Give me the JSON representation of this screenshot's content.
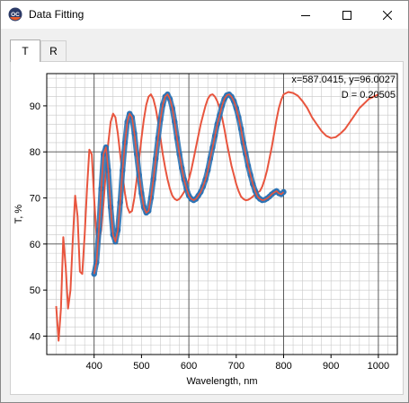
{
  "window": {
    "title": "Data Fitting",
    "icon": "app-logo-icon",
    "controls": {
      "minimize": "minimize-icon",
      "maximize": "maximize-icon",
      "close": "close-icon"
    }
  },
  "tabs": [
    {
      "label": "T",
      "active": true
    },
    {
      "label": "R",
      "active": false
    }
  ],
  "readout": {
    "coords": "x=587.0415, y=96.0027",
    "d_value": "D = 0.20505"
  },
  "colors": {
    "measured": "#2e74b5",
    "fit": "#e8553e",
    "grid_major": "#4d4d4d",
    "grid_minor": "#c8c8c8"
  },
  "chart_data": {
    "type": "line",
    "xlabel": "Wavelength, nm",
    "ylabel": "T, %",
    "xlim": [
      300,
      1040
    ],
    "ylim": [
      36,
      97
    ],
    "xticks": [
      400,
      500,
      600,
      700,
      800,
      900,
      1000
    ],
    "yticks": [
      40,
      50,
      60,
      70,
      80,
      90
    ],
    "grid": true,
    "series": [
      {
        "kind": "line",
        "color": "#e8553e",
        "x": [
          320,
          325,
          330,
          335,
          340,
          345,
          350,
          355,
          360,
          365,
          370,
          375,
          380,
          385,
          390,
          395,
          400,
          405,
          410,
          415,
          420,
          425,
          430,
          435,
          440,
          445,
          450,
          455,
          460,
          465,
          470,
          475,
          480,
          485,
          490,
          495,
          500,
          505,
          510,
          515,
          520,
          525,
          530,
          535,
          540,
          545,
          550,
          555,
          560,
          565,
          570,
          575,
          580,
          585,
          590,
          595,
          600,
          605,
          610,
          615,
          620,
          625,
          630,
          635,
          640,
          645,
          650,
          655,
          660,
          665,
          670,
          675,
          680,
          685,
          690,
          695,
          700,
          705,
          710,
          715,
          720,
          725,
          730,
          735,
          740,
          745,
          750,
          755,
          760,
          765,
          770,
          775,
          780,
          785,
          790,
          795,
          800,
          810,
          820,
          830,
          840,
          850,
          860,
          870,
          880,
          890,
          900,
          910,
          920,
          930,
          940,
          950,
          960,
          970,
          980,
          990,
          1000
        ],
        "y": [
          46.5,
          39,
          46,
          61.5,
          55,
          46,
          50,
          61,
          70.5,
          66,
          54,
          53.5,
          62,
          72,
          80.5,
          79.5,
          70,
          62,
          60.5,
          63,
          69,
          76,
          82,
          86.5,
          88.3,
          87.5,
          84,
          79.5,
          75,
          71,
          68,
          66.8,
          67.2,
          70,
          74,
          78.5,
          83,
          87,
          90.2,
          92,
          92.5,
          91.5,
          89.5,
          86.5,
          83,
          79.5,
          76.5,
          74,
          72,
          70.5,
          69.8,
          69.5,
          69.8,
          70.5,
          71.3,
          72.5,
          74,
          76,
          78.5,
          81,
          83.5,
          86,
          88,
          90,
          91.5,
          92.3,
          92.5,
          92,
          91,
          89.5,
          87.5,
          85,
          82,
          79.5,
          77,
          75,
          73,
          71.5,
          70.3,
          69.8,
          69.5,
          69.6,
          69.9,
          70.3,
          70.8,
          71.2,
          71.5,
          72.5,
          74,
          76,
          78.5,
          81,
          84,
          87,
          89.5,
          91.3,
          92.5,
          93,
          92.8,
          92.2,
          91,
          89.5,
          87.5,
          86,
          84.5,
          83.5,
          83,
          83.2,
          84,
          85,
          86.5,
          88,
          89.5,
          90.5,
          91.5,
          92,
          92.5
        ]
      },
      {
        "kind": "markers",
        "color": "#2e74b5",
        "x": [
          400,
          405,
          410,
          415,
          420,
          425,
          430,
          435,
          440,
          445,
          450,
          455,
          460,
          465,
          470,
          475,
          480,
          485,
          490,
          495,
          500,
          505,
          510,
          515,
          520,
          525,
          530,
          535,
          540,
          545,
          550,
          555,
          560,
          565,
          570,
          575,
          580,
          585,
          590,
          595,
          600,
          605,
          610,
          615,
          620,
          625,
          630,
          635,
          640,
          645,
          650,
          655,
          660,
          665,
          670,
          675,
          680,
          685,
          690,
          695,
          700,
          705,
          710,
          715,
          720,
          725,
          730,
          735,
          740,
          745,
          750,
          755,
          760,
          765,
          770,
          775,
          780,
          785,
          790,
          795,
          800
        ],
        "y": [
          53.5,
          56,
          63,
          72,
          79.5,
          81,
          76,
          68,
          62,
          60.5,
          63,
          69,
          76,
          82,
          86.5,
          88.3,
          87.5,
          84,
          79.5,
          75,
          71,
          68,
          66.8,
          67.2,
          70,
          74,
          78.5,
          83,
          87,
          90.2,
          92,
          92.5,
          91.5,
          89.5,
          86.5,
          83,
          79.5,
          76.5,
          74,
          72,
          70.5,
          69.8,
          69.5,
          69.8,
          70.5,
          71.3,
          72.5,
          74,
          76,
          78.5,
          81,
          83.5,
          86,
          88,
          90,
          91.5,
          92.3,
          92.5,
          92,
          91,
          89.5,
          87.5,
          85,
          82,
          79.5,
          77,
          75,
          73,
          71.5,
          70.3,
          69.8,
          69.5,
          69.6,
          69.9,
          70.3,
          70.8,
          71.2,
          71.5,
          71,
          70.8,
          71.3
        ]
      }
    ]
  }
}
